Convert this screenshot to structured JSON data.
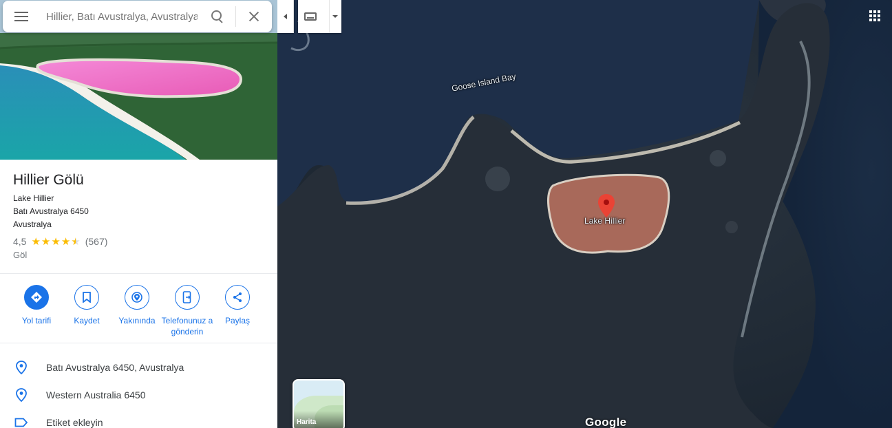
{
  "search": {
    "placeholder": "Hillier, Batı Avustralya, Avustralya"
  },
  "place": {
    "title": "Hillier Gölü",
    "address_lines": [
      "Lake Hillier",
      "Batı Avustralya 6450",
      "Avustralya"
    ],
    "rating": "4,5",
    "stars": 4.5,
    "review_count": "(567)",
    "type": "Göl"
  },
  "actions": [
    {
      "label": "Yol tarifi",
      "icon": "directions-icon"
    },
    {
      "label": "Kaydet",
      "icon": "bookmark-icon"
    },
    {
      "label": "Yakınında",
      "icon": "nearby-icon"
    },
    {
      "label": "Telefonunuz a gönderin",
      "icon": "send-to-phone-icon"
    },
    {
      "label": "Paylaş",
      "icon": "share-icon"
    }
  ],
  "info_rows": [
    {
      "text": "Batı Avustralya 6450, Avustralya",
      "icon": "location-pin-icon"
    },
    {
      "text": "Western Australia 6450",
      "icon": "location-pin-icon"
    },
    {
      "text": "Etiket ekleyin",
      "icon": "label-icon"
    }
  ],
  "map": {
    "bay_label": "Goose Island Bay",
    "lake_label": "Lake Hillier",
    "layer_label": "Harita",
    "logo": "Google"
  },
  "colors": {
    "accent": "#1a73e8",
    "star": "#fbbc04",
    "pin": "#ea4335",
    "lake": "#a8695a"
  }
}
